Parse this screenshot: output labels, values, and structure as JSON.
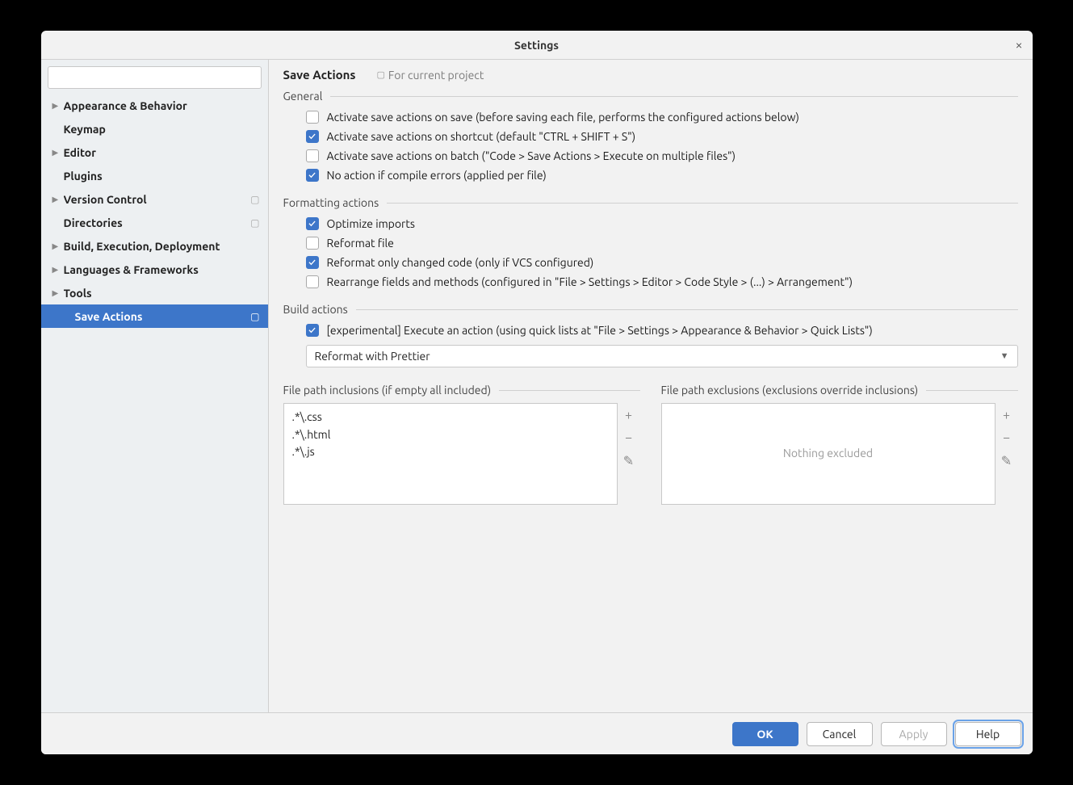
{
  "window": {
    "title": "Settings"
  },
  "search": {
    "placeholder": ""
  },
  "sidebar": {
    "items": [
      {
        "label": "Appearance & Behavior",
        "expandable": true
      },
      {
        "label": "Keymap",
        "expandable": false
      },
      {
        "label": "Editor",
        "expandable": true
      },
      {
        "label": "Plugins",
        "expandable": false
      },
      {
        "label": "Version Control",
        "expandable": true,
        "badge": true
      },
      {
        "label": "Directories",
        "expandable": false,
        "badge": true
      },
      {
        "label": "Build, Execution, Deployment",
        "expandable": true
      },
      {
        "label": "Languages & Frameworks",
        "expandable": true
      },
      {
        "label": "Tools",
        "expandable": true
      },
      {
        "label": "Save Actions",
        "expandable": false,
        "selected": true,
        "child": true,
        "badge": true
      }
    ]
  },
  "header": {
    "title": "Save Actions",
    "scope": "For current project"
  },
  "groups": {
    "general": {
      "title": "General",
      "options": [
        {
          "checked": false,
          "label": "Activate save actions on save (before saving each file, performs the configured actions below)"
        },
        {
          "checked": true,
          "label": "Activate save actions on shortcut (default \"CTRL + SHIFT + S\")"
        },
        {
          "checked": false,
          "label": "Activate save actions on batch (\"Code > Save Actions > Execute on multiple files\")"
        },
        {
          "checked": true,
          "label": "No action if compile errors (applied per file)"
        }
      ]
    },
    "formatting": {
      "title": "Formatting actions",
      "options": [
        {
          "checked": true,
          "label": "Optimize imports"
        },
        {
          "checked": false,
          "label": "Reformat file"
        },
        {
          "checked": true,
          "label": "Reformat only changed code (only if VCS configured)"
        },
        {
          "checked": false,
          "label": "Rearrange fields and methods (configured in \"File > Settings > Editor > Code Style > (...) > Arrangement\")"
        }
      ]
    },
    "build": {
      "title": "Build actions",
      "options": [
        {
          "checked": true,
          "label": "[experimental] Execute an action (using quick lists at \"File > Settings > Appearance & Behavior > Quick Lists\")"
        }
      ],
      "combo": "Reformat with Prettier"
    }
  },
  "inclusions": {
    "title": "File path inclusions (if empty all included)",
    "items": [
      ".*\\.css",
      ".*\\.html",
      ".*\\.js"
    ]
  },
  "exclusions": {
    "title": "File path exclusions (exclusions override inclusions)",
    "empty": "Nothing excluded"
  },
  "footer": {
    "ok": "OK",
    "cancel": "Cancel",
    "apply": "Apply",
    "help": "Help"
  }
}
